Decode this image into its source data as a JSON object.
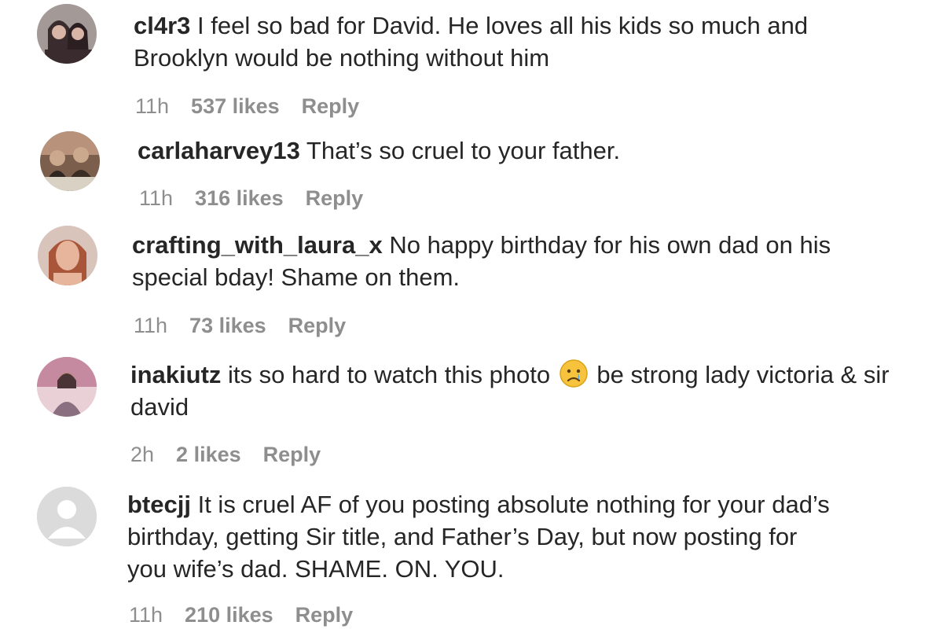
{
  "comments": [
    {
      "username": "cl4r3",
      "text": "I feel so bad for David. He loves all his kids so much and Brooklyn would be nothing without him",
      "time": "11h",
      "likes": "537 likes",
      "reply": "Reply",
      "avatar_colors": [
        "#a39a98",
        "#3a2b2e",
        "#c9a89c"
      ]
    },
    {
      "username": "carlaharvey13",
      "text": "That’s so cruel to your father.",
      "time": "11h",
      "likes": "316 likes",
      "reply": "Reply",
      "avatar_colors": [
        "#7c5e4c",
        "#2f2622",
        "#caa98d"
      ]
    },
    {
      "username": "crafting_with_laura_x",
      "text": "No happy birthday for his own dad on his special bday! Shame on them.",
      "time": "11h",
      "likes": "73 likes",
      "reply": "Reply",
      "avatar_colors": [
        "#d9c4bc",
        "#a8553a",
        "#e6b59c"
      ]
    },
    {
      "username": "inakiutz",
      "text_before": "its so hard to watch this photo",
      "emoji": "crying-face-emoji",
      "text_after": "be strong lady victoria & sir david",
      "time": "2h",
      "likes": "2 likes",
      "reply": "Reply",
      "avatar_colors": [
        "#c58aa0",
        "#8a6f80",
        "#e8d0d6"
      ]
    },
    {
      "username": "btecjj",
      "text": "It is cruel AF of you posting absolute nothing for your dad’s birthday, getting Sir title, and Father’s Day, but now posting for you wife’s dad. SHAME. ON. YOU.",
      "time": "11h",
      "likes": "210 likes",
      "reply": "Reply",
      "avatar_colors": [
        "#dbdbdb",
        "#ffffff"
      ]
    }
  ]
}
